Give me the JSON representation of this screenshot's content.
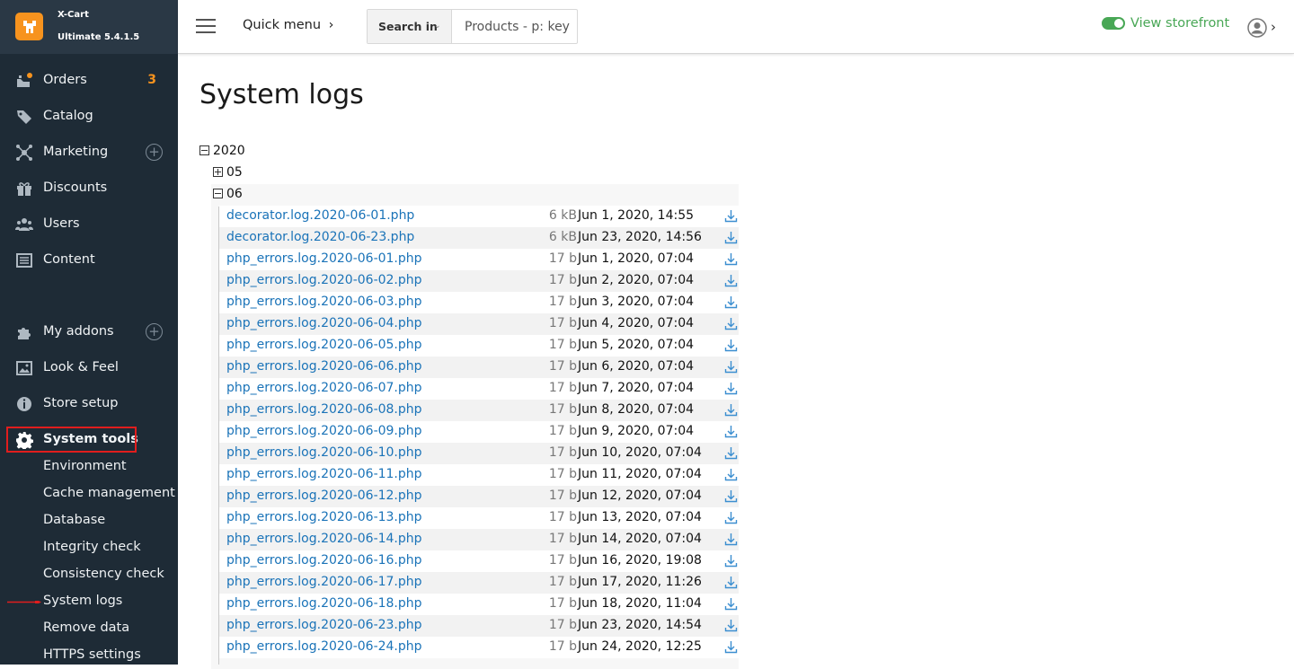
{
  "brand": {
    "name": "X-Cart",
    "version": "Ultimate 5.4.1.5"
  },
  "header": {
    "quick_menu": "Quick menu",
    "search_in": "Search in",
    "search_placeholder": "Products - p: key",
    "view_storefront": "View storefront"
  },
  "sidebar": {
    "items": [
      {
        "label": "Orders",
        "badge": "3",
        "icon": "orders-icon"
      },
      {
        "label": "Catalog",
        "icon": "tag-icon"
      },
      {
        "label": "Marketing",
        "icon": "marketing-icon"
      },
      {
        "label": "Discounts",
        "icon": "gift-icon"
      },
      {
        "label": "Users",
        "icon": "users-icon"
      },
      {
        "label": "Content",
        "icon": "content-icon"
      },
      {
        "label": "My addons",
        "icon": "puzzle-icon"
      },
      {
        "label": "Look & Feel",
        "icon": "image-icon"
      },
      {
        "label": "Store setup",
        "icon": "info-icon"
      },
      {
        "label": "System tools",
        "icon": "gear-icon"
      }
    ],
    "system_tools_sub": [
      "Environment",
      "Cache management",
      "Database",
      "Integrity check",
      "Consistency check",
      "System logs",
      "Remove data",
      "HTTPS settings"
    ]
  },
  "main": {
    "title": "System logs",
    "year": "2020",
    "months": [
      "05",
      "06"
    ],
    "files": [
      {
        "name": "decorator.log.2020-06-01.php",
        "size": "6 kB",
        "date": "Jun 1, 2020, 14:55"
      },
      {
        "name": "decorator.log.2020-06-23.php",
        "size": "6 kB",
        "date": "Jun 23, 2020, 14:56"
      },
      {
        "name": "php_errors.log.2020-06-01.php",
        "size": "17 b",
        "date": "Jun 1, 2020, 07:04"
      },
      {
        "name": "php_errors.log.2020-06-02.php",
        "size": "17 b",
        "date": "Jun 2, 2020, 07:04"
      },
      {
        "name": "php_errors.log.2020-06-03.php",
        "size": "17 b",
        "date": "Jun 3, 2020, 07:04"
      },
      {
        "name": "php_errors.log.2020-06-04.php",
        "size": "17 b",
        "date": "Jun 4, 2020, 07:04"
      },
      {
        "name": "php_errors.log.2020-06-05.php",
        "size": "17 b",
        "date": "Jun 5, 2020, 07:04"
      },
      {
        "name": "php_errors.log.2020-06-06.php",
        "size": "17 b",
        "date": "Jun 6, 2020, 07:04"
      },
      {
        "name": "php_errors.log.2020-06-07.php",
        "size": "17 b",
        "date": "Jun 7, 2020, 07:04"
      },
      {
        "name": "php_errors.log.2020-06-08.php",
        "size": "17 b",
        "date": "Jun 8, 2020, 07:04"
      },
      {
        "name": "php_errors.log.2020-06-09.php",
        "size": "17 b",
        "date": "Jun 9, 2020, 07:04"
      },
      {
        "name": "php_errors.log.2020-06-10.php",
        "size": "17 b",
        "date": "Jun 10, 2020, 07:04"
      },
      {
        "name": "php_errors.log.2020-06-11.php",
        "size": "17 b",
        "date": "Jun 11, 2020, 07:04"
      },
      {
        "name": "php_errors.log.2020-06-12.php",
        "size": "17 b",
        "date": "Jun 12, 2020, 07:04"
      },
      {
        "name": "php_errors.log.2020-06-13.php",
        "size": "17 b",
        "date": "Jun 13, 2020, 07:04"
      },
      {
        "name": "php_errors.log.2020-06-14.php",
        "size": "17 b",
        "date": "Jun 14, 2020, 07:04"
      },
      {
        "name": "php_errors.log.2020-06-16.php",
        "size": "17 b",
        "date": "Jun 16, 2020, 19:08"
      },
      {
        "name": "php_errors.log.2020-06-17.php",
        "size": "17 b",
        "date": "Jun 17, 2020, 11:26"
      },
      {
        "name": "php_errors.log.2020-06-18.php",
        "size": "17 b",
        "date": "Jun 18, 2020, 11:04"
      },
      {
        "name": "php_errors.log.2020-06-23.php",
        "size": "17 b",
        "date": "Jun 23, 2020, 14:54"
      },
      {
        "name": "php_errors.log.2020-06-24.php",
        "size": "17 b",
        "date": "Jun 24, 2020, 12:25"
      }
    ]
  },
  "colors": {
    "sidebar_bg": "#1e2b36",
    "accent": "#f7931e",
    "link": "#1a73b8",
    "storefront_green": "#48a755",
    "highlight_red": "#e11d1d"
  }
}
